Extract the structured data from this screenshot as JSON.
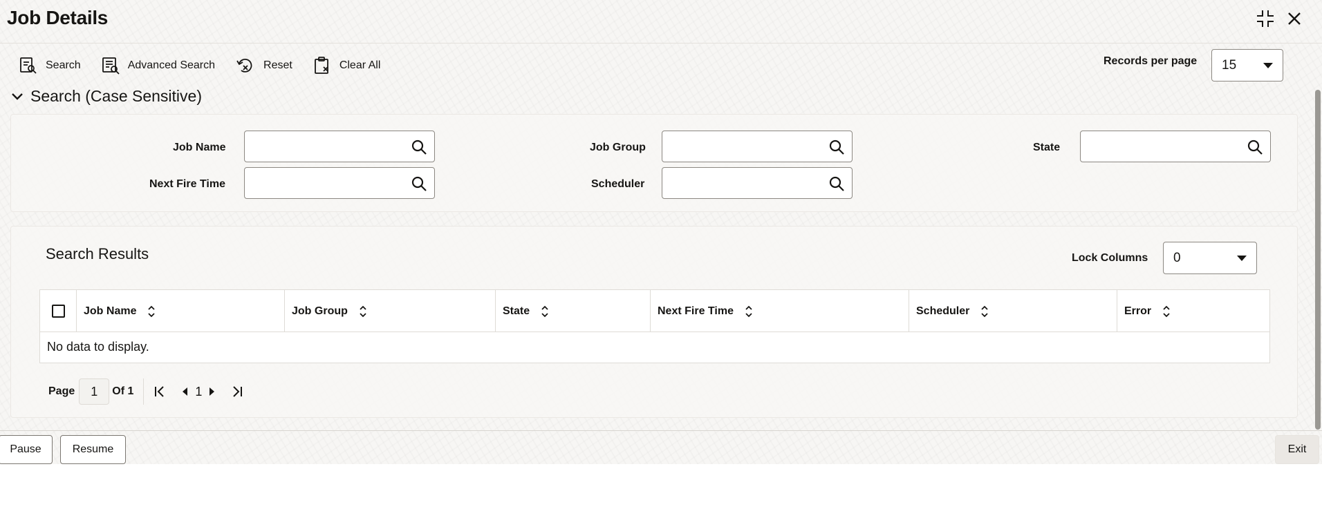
{
  "window": {
    "title": "Job Details"
  },
  "toolbar": {
    "search_label": "Search",
    "advanced_search_label": "Advanced Search",
    "reset_label": "Reset",
    "clear_all_label": "Clear All"
  },
  "records_per_page": {
    "label": "Records per page",
    "value": "15"
  },
  "search_section": {
    "title": "Search (Case Sensitive)",
    "fields": {
      "job_name": {
        "label": "Job Name",
        "value": ""
      },
      "job_group": {
        "label": "Job Group",
        "value": ""
      },
      "state": {
        "label": "State",
        "value": ""
      },
      "next_fire_time": {
        "label": "Next Fire Time",
        "value": ""
      },
      "scheduler": {
        "label": "Scheduler",
        "value": ""
      }
    }
  },
  "results": {
    "title": "Search Results",
    "lock_columns": {
      "label": "Lock Columns",
      "value": "0"
    },
    "columns": [
      "Job Name",
      "Job Group",
      "State",
      "Next Fire Time",
      "Scheduler",
      "Error"
    ],
    "empty_message": "No data to display.",
    "pagination": {
      "page_label": "Page",
      "current_page": "1",
      "of_label": "Of 1",
      "nav_page": "1"
    }
  },
  "footer": {
    "pause_label": "Pause",
    "resume_label": "Resume",
    "exit_label": "Exit"
  },
  "icons": {
    "minimize": "collapse-icon",
    "close": "close-icon",
    "search_field": "search-icon",
    "sort": "sort-icon",
    "section_toggle": "chevron-down-icon"
  }
}
